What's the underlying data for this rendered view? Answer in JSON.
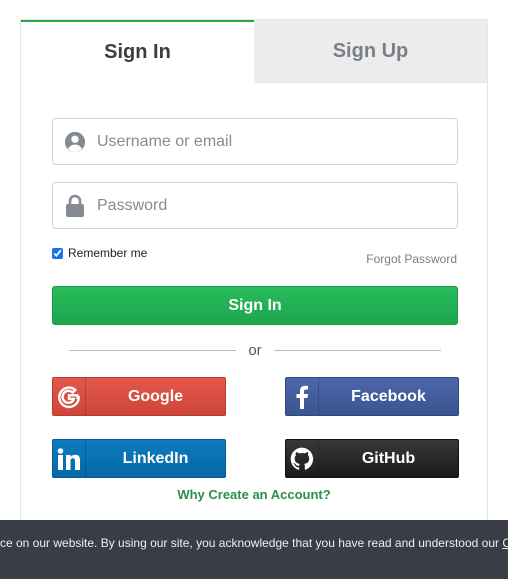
{
  "tabs": [
    {
      "label": "Sign In",
      "active": true
    },
    {
      "label": "Sign Up",
      "active": false
    }
  ],
  "username": {
    "placeholder": "Username or email",
    "value": "",
    "icon": "user-icon"
  },
  "password": {
    "placeholder": "Password",
    "value": "",
    "icon": "lock-icon"
  },
  "remember": {
    "label": "Remember me",
    "checked": true
  },
  "forgot_label": "Forgot Password",
  "signin_label": "Sign In",
  "divider_label": "or",
  "social": {
    "google": {
      "label": "Google",
      "icon": "google-icon",
      "color": "#dd4b39"
    },
    "facebook": {
      "label": "Facebook",
      "icon": "facebook-icon",
      "color": "#3b5998"
    },
    "linkedin": {
      "label": "LinkedIn",
      "icon": "linkedin-icon",
      "color": "#0e76a8"
    },
    "github": {
      "label": "GitHub",
      "icon": "github-icon",
      "color": "#24292e"
    }
  },
  "why_link": "Why Create an Account?",
  "cookie": {
    "text": "ce on our website. By using our site, you acknowledge that you have read and understood our ",
    "link": "C"
  },
  "colors": {
    "accent": "#28a745",
    "cookie_bg": "#393d45"
  }
}
